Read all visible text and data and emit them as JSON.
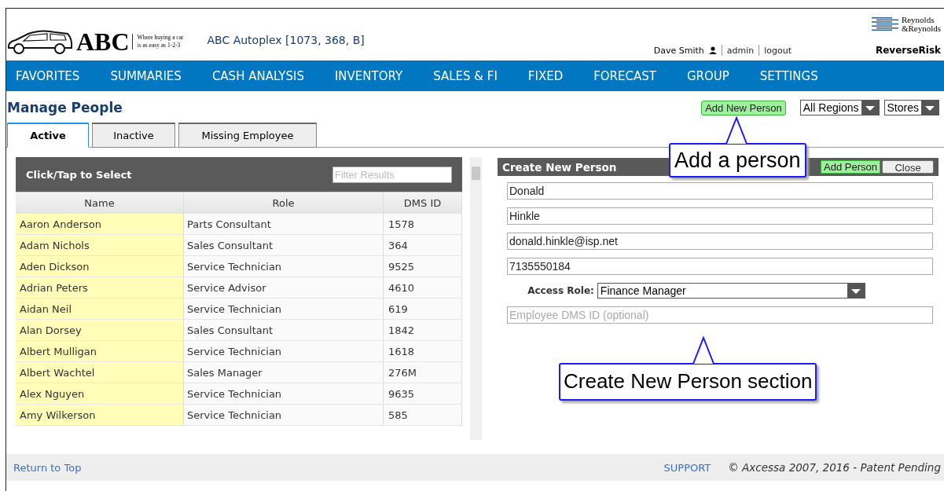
{
  "header": {
    "logo_text": "ABC",
    "tagline_1": "Where buying a car",
    "tagline_2": "is as easy as 1-2-3",
    "dealer": "ABC Autoplex [1073, 368, B]",
    "user": "Dave Smith",
    "links": [
      "admin",
      "logout"
    ],
    "brand_1": "Reynolds",
    "brand_2": "&Reynolds",
    "product": "ReverseRisk"
  },
  "nav": [
    "FAVORITES",
    "SUMMARIES",
    "CASH ANALYSIS",
    "INVENTORY",
    "SALES & FI",
    "FIXED",
    "FORECAST",
    "GROUP",
    "SETTINGS"
  ],
  "page_title": "Manage People",
  "actions": {
    "add_button": "Add New Person",
    "regions": "All Regions",
    "stores": "Stores"
  },
  "tabs": [
    {
      "label": "Active",
      "selected": true
    },
    {
      "label": "Inactive",
      "selected": false
    },
    {
      "label": "Missing Employee",
      "selected": false
    }
  ],
  "list": {
    "title": "Click/Tap to Select",
    "filter_placeholder": "Filter Results",
    "columns": [
      "Name",
      "Role",
      "DMS ID"
    ],
    "rows": [
      {
        "name": "Aaron Anderson",
        "role": "Parts Consultant",
        "dms_id": "1578"
      },
      {
        "name": "Adam Nichols",
        "role": "Sales Consultant",
        "dms_id": "364"
      },
      {
        "name": "Aden Dickson",
        "role": "Service Technician",
        "dms_id": "9525"
      },
      {
        "name": "Adrian Peters",
        "role": "Service Advisor",
        "dms_id": "4610"
      },
      {
        "name": "Aidan Neil",
        "role": "Service Technician",
        "dms_id": "619"
      },
      {
        "name": "Alan Dorsey",
        "role": "Sales Consultant",
        "dms_id": "1842"
      },
      {
        "name": "Albert Mulligan",
        "role": "Service Technician",
        "dms_id": "1618"
      },
      {
        "name": "Albert Wachtel",
        "role": "Sales Manager",
        "dms_id": "276M"
      },
      {
        "name": "Alex Nguyen",
        "role": "Service Technician",
        "dms_id": "9635"
      },
      {
        "name": "Amy Wilkerson",
        "role": "Service Technician",
        "dms_id": "585"
      }
    ]
  },
  "form": {
    "title": "Create New Person",
    "add_button": "Add Person",
    "close_button": "Close",
    "fields": [
      {
        "value": "Donald"
      },
      {
        "value": "Hinkle"
      },
      {
        "value": "donald.hinkle@isp.net"
      },
      {
        "value": "7135550184"
      }
    ],
    "access_role_label": "Access Role:",
    "access_role": "Finance Manager",
    "dms_placeholder": "Employee DMS ID (optional)"
  },
  "callouts": [
    "Add a person",
    "Create New Person section"
  ],
  "footer": {
    "return_link": "Return to Top",
    "support": "SUPPORT",
    "copyright": "© Axcessa 2007, 2016 - Patent Pending"
  }
}
